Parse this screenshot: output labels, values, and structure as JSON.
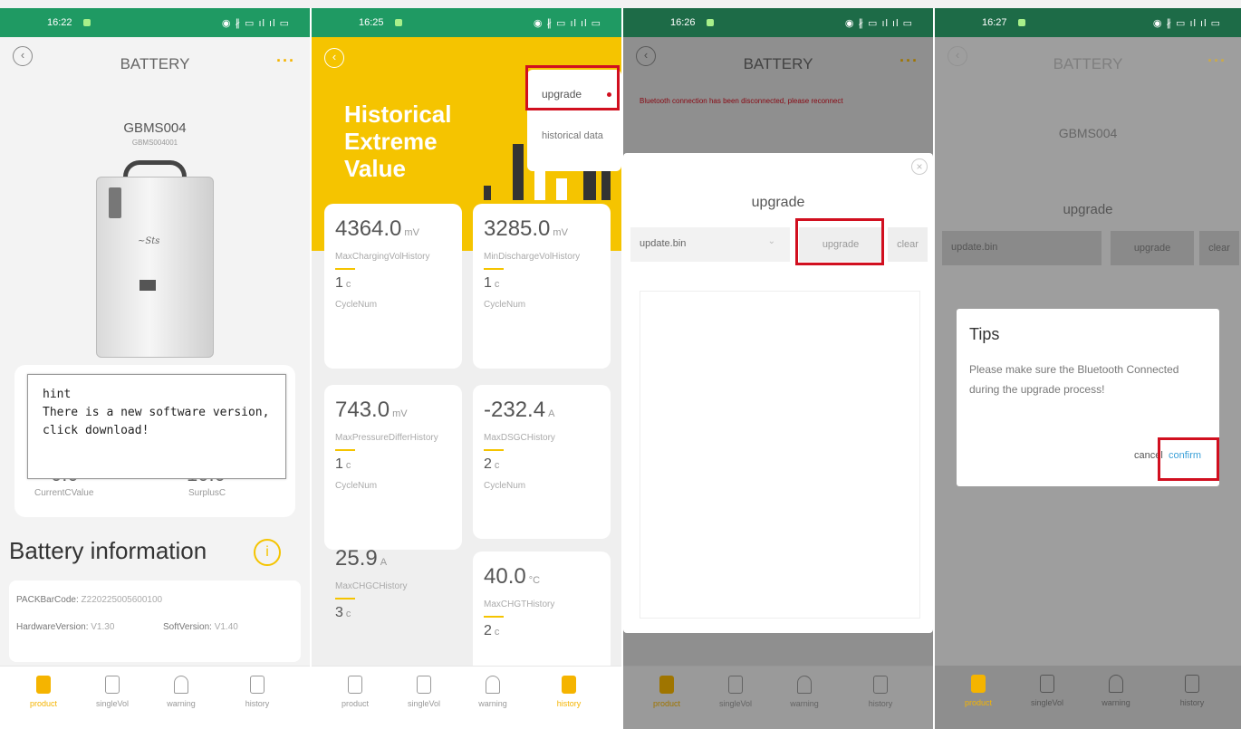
{
  "status": {
    "p1_time": "16:22",
    "p2_time": "16:25",
    "p3_time": "16:26",
    "p4_time": "16:27",
    "icons": "◉ ∦ ▭ ıl ıl ▭"
  },
  "header": {
    "title": "BATTERY",
    "back": "‹",
    "more": "···"
  },
  "device": {
    "model": "GBMS004",
    "serial": "GBMS004001"
  },
  "hint": {
    "title": "hint",
    "message": "There is a new software version, click download!"
  },
  "stats": {
    "left_value": "0.0",
    "left_label": "CurrentCValue",
    "right_value": "10.0",
    "right_label": "SurplusC"
  },
  "battery_info": {
    "title": "Battery information",
    "info_icon": "i",
    "pack_label": "PACKBarCode:",
    "pack_value": "Z220225005600100",
    "hw_label": "HardwareVersion:",
    "hw_value": "V1.30",
    "sw_label": "SoftVersion:",
    "sw_value": "V1.40"
  },
  "tabs": [
    {
      "label": "product",
      "icon": "battery-pack-icon"
    },
    {
      "label": "singleVol",
      "icon": "battery-icon"
    },
    {
      "label": "warning",
      "icon": "bell-icon"
    },
    {
      "label": "history",
      "icon": "calendar-icon"
    }
  ],
  "history": {
    "title_line1": "Historical",
    "title_line2": "Extreme",
    "title_line3": "Value",
    "menu": {
      "upgrade": "upgrade",
      "historical": "historical data"
    },
    "cards": [
      {
        "value": "4364.0",
        "unit": "mV",
        "label": "MaxChargingVolHistory",
        "cycle": "1",
        "cycle_unit": "c",
        "cycle_label": "CycleNum"
      },
      {
        "value": "3285.0",
        "unit": "mV",
        "label": "MinDischargeVolHistory",
        "cycle": "1",
        "cycle_unit": "c",
        "cycle_label": "CycleNum"
      },
      {
        "value": "743.0",
        "unit": "mV",
        "label": "MaxPressureDifferHistory",
        "cycle": "1",
        "cycle_unit": "c",
        "cycle_label": "CycleNum"
      },
      {
        "value": "-232.4",
        "unit": "A",
        "label": "MaxDSGCHistory",
        "cycle": "2",
        "cycle_unit": "c",
        "cycle_label": "CycleNum"
      },
      {
        "value": "25.9",
        "unit": "A",
        "label": "MaxCHGCHistory",
        "cycle": "3",
        "cycle_unit": "c",
        "cycle_label": ""
      },
      {
        "value": "40.0",
        "unit": "°C",
        "label": "MaxCHGTHistory",
        "cycle": "2",
        "cycle_unit": "c",
        "cycle_label": ""
      }
    ]
  },
  "upgrade_dialog": {
    "warning": "Bluetooth connection has been disconnected, please reconnect",
    "title": "upgrade",
    "file": "update.bin",
    "upgrade_btn": "upgrade",
    "clear_btn": "clear",
    "close": "×"
  },
  "tips": {
    "title": "Tips",
    "message": "Please make sure the Bluetooth Connected during the upgrade process!",
    "cancel": "cancel",
    "confirm": "confirm"
  },
  "colors": {
    "green": "#1f9a63",
    "yellow": "#f5c400",
    "red": "#d10f1f"
  }
}
